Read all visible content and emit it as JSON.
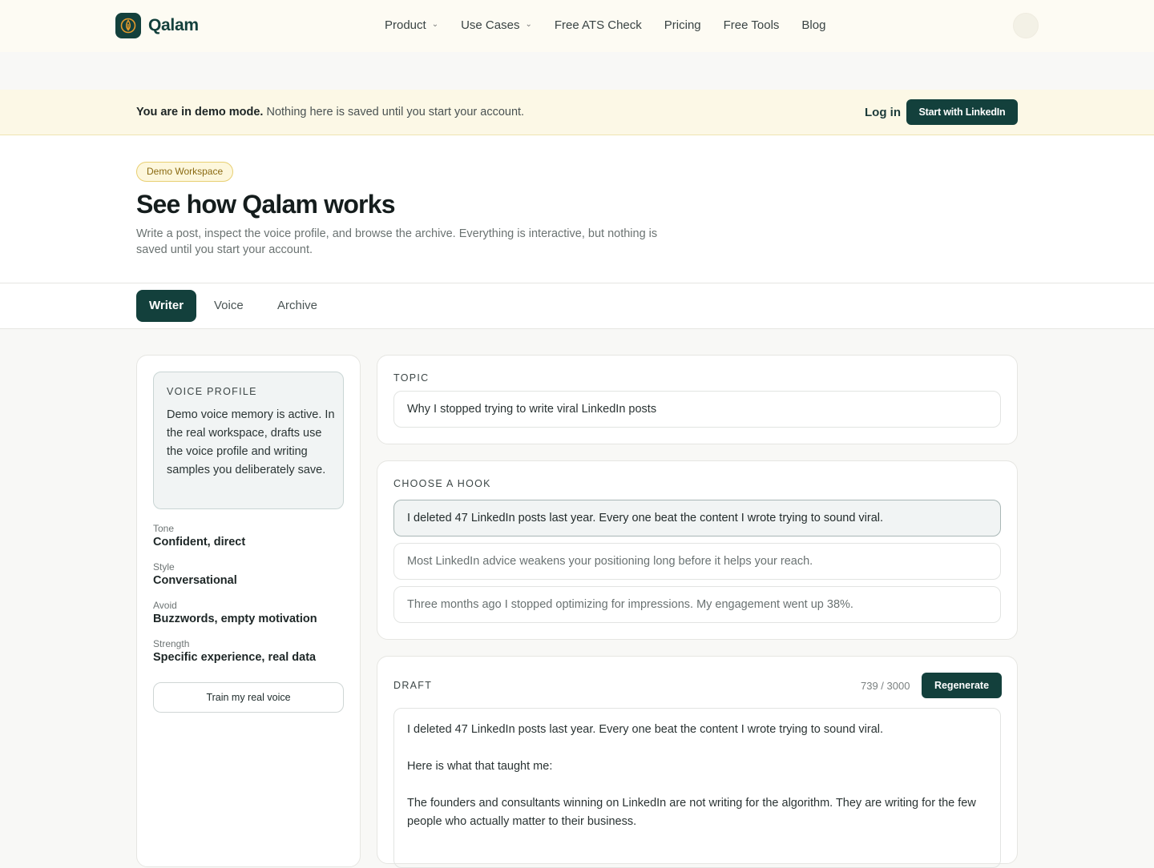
{
  "nav": {
    "logo_text": "Qalam",
    "links": [
      {
        "label": "Product",
        "dropdown": true
      },
      {
        "label": "Use Cases",
        "dropdown": true
      },
      {
        "label": "Free ATS Check"
      },
      {
        "label": "Pricing"
      },
      {
        "label": "Free Tools"
      },
      {
        "label": "Blog"
      }
    ]
  },
  "banner": {
    "bold": "You are in demo mode.",
    "text": " Nothing here is saved until you start your account.",
    "login_label": "Log in",
    "start_label": "Start with LinkedIn"
  },
  "hero": {
    "badge": "Demo Workspace",
    "title": "See how Qalam works",
    "subtitle": "Write a post, inspect the voice profile, and browse the archive. Everything is interactive, but nothing is saved until you start your account."
  },
  "tabs": [
    {
      "label": "Writer",
      "active": true
    },
    {
      "label": "Voice"
    },
    {
      "label": "Archive"
    }
  ],
  "voice_profile": {
    "heading": "Voice Profile",
    "text": "Demo voice memory is active. In the real workspace, drafts use the voice profile and writing samples you deliberately save.",
    "attributes": [
      {
        "label": "Tone",
        "value": "Confident, direct"
      },
      {
        "label": "Style",
        "value": "Conversational"
      },
      {
        "label": "Avoid",
        "value": "Buzzwords, empty motivation"
      },
      {
        "label": "Strength",
        "value": "Specific experience, real data"
      }
    ],
    "train_label": "Train my real voice"
  },
  "topic": {
    "heading": "Topic",
    "value": "Why I stopped trying to write viral LinkedIn posts"
  },
  "hooks": {
    "heading": "Choose a hook",
    "items": [
      "I deleted 47 LinkedIn posts last year. Every one beat the content I wrote trying to sound viral.",
      "Most LinkedIn advice weakens your positioning long before it helps your reach.",
      "Three months ago I stopped optimizing for impressions. My engagement went up 38%."
    ],
    "selected_index": 0
  },
  "draft": {
    "heading": "Draft",
    "counter": "739 / 3000",
    "regenerate_label": "Regenerate",
    "paragraphs": [
      "I deleted 47 LinkedIn posts last year. Every one beat the content I wrote trying to sound viral.",
      "Here is what that taught me:",
      "The founders and consultants winning on LinkedIn are not writing for the algorithm. They are writing for the few people who actually matter to their business."
    ]
  },
  "colors": {
    "brand": "#13403c",
    "banner_bg": "#fcf8e6",
    "badge_border": "#e8cf72",
    "logo_accent": "#e39a2c"
  }
}
